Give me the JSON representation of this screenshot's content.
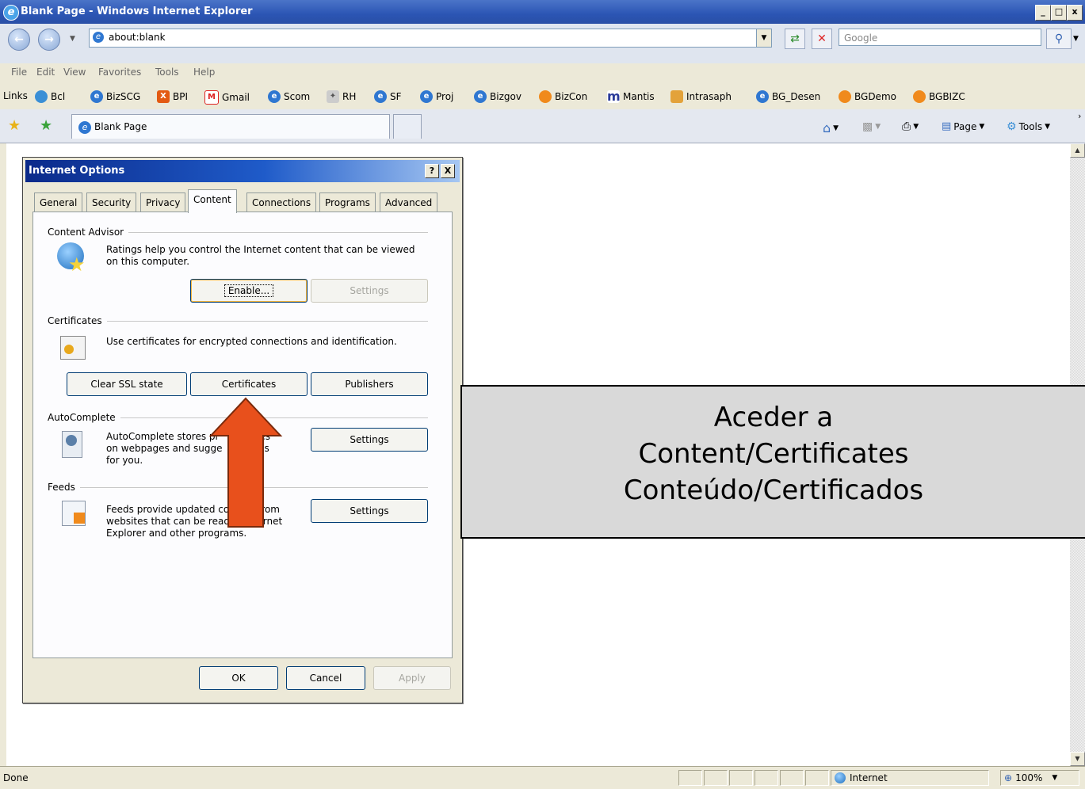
{
  "window": {
    "title": "Blank Page - Windows Internet Explorer"
  },
  "address": {
    "url": "about:blank",
    "search_placeholder": "Google"
  },
  "menu": [
    "File",
    "Edit",
    "View",
    "Favorites",
    "Tools",
    "Help"
  ],
  "links": {
    "label": "Links",
    "items": [
      "Bcl",
      "BizSCG",
      "BPI",
      "Gmail",
      "Scom",
      "RH",
      "SF",
      "Proj",
      "Bizgov",
      "BizCon",
      "Mantis",
      "Intrasaph",
      "BG_Desen",
      "BGDemo",
      "BGBIZC"
    ]
  },
  "tab": {
    "title": "Blank Page"
  },
  "commands": {
    "page": "Page",
    "tools": "Tools"
  },
  "dialog": {
    "title": "Internet Options",
    "help": "?",
    "close": "X",
    "tabs": [
      "General",
      "Security",
      "Privacy",
      "Content",
      "Connections",
      "Programs",
      "Advanced"
    ],
    "content_advisor": {
      "heading": "Content Advisor",
      "text": "Ratings help you control the Internet content that can be viewed on this computer.",
      "enable": "Enable...",
      "settings": "Settings"
    },
    "certificates": {
      "heading": "Certificates",
      "text": "Use certificates for encrypted connections and identification.",
      "clear_ssl": "Clear SSL state",
      "certificates": "Certificates",
      "publishers": "Publishers"
    },
    "autocomplete": {
      "heading": "AutoComplete",
      "line1": "AutoComplete stores pr      entries",
      "line2": "on webpages and sugge       tches",
      "line3": "for you.",
      "settings": "Settings"
    },
    "feeds": {
      "heading": "Feeds",
      "text": "Feeds provide updated content from websites that can be read in Internet Explorer and other programs.",
      "settings": "Settings"
    },
    "ok": "OK",
    "cancel": "Cancel",
    "apply": "Apply"
  },
  "callout": {
    "line1": "Aceder a",
    "line2": "Content/Certificates",
    "line3": "Conteúdo/Certificados"
  },
  "status": {
    "text": "Done",
    "zone": "Internet",
    "zoom": "100%"
  },
  "colors": {
    "arrow": "#e8501c",
    "titlebar": "#2b55b4",
    "dialog_title": "#0b2a8a"
  }
}
